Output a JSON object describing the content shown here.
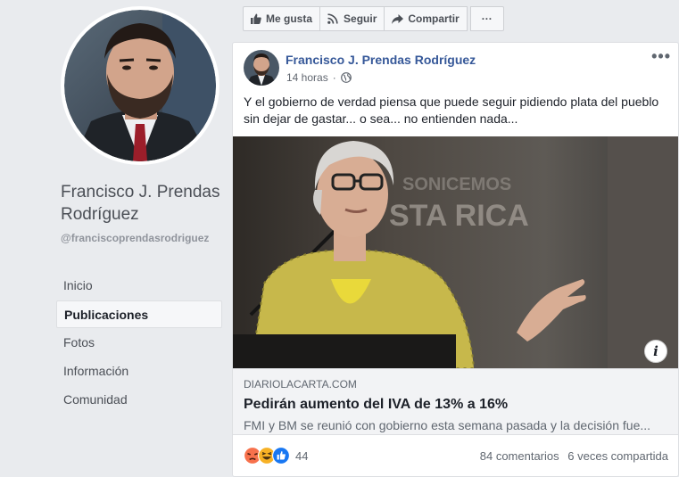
{
  "profile": {
    "name": "Francisco J. Prendas Rodríguez",
    "handle": "@franciscoprendasrodriguez"
  },
  "nav": {
    "items": [
      {
        "label": "Inicio",
        "active": false
      },
      {
        "label": "Publicaciones",
        "active": true
      },
      {
        "label": "Fotos",
        "active": false
      },
      {
        "label": "Información",
        "active": false
      },
      {
        "label": "Comunidad",
        "active": false
      }
    ]
  },
  "actions": {
    "like_label": "Me gusta",
    "follow_label": "Seguir",
    "share_label": "Compartir",
    "more_label": "···"
  },
  "post": {
    "author": "Francisco J. Prendas Rodríguez",
    "time": "14 horas",
    "menu": "•••",
    "text": "Y el gobierno de verdad piensa que puede seguir pidiendo plata del pueblo sin dejar de gastar... o sea... no entienden nada...",
    "link": {
      "domain": "DIARIOLACARTA.COM",
      "title": "Pedirán aumento del IVA de 13% a 16%",
      "description": "FMI y BM se reunió con gobierno esta semana pasada y la decisión fue..."
    },
    "image_bg_text_1": "SONICEMOS",
    "image_bg_text_2": "STA RICA",
    "reaction_count": "44",
    "comments": "84 comentarios",
    "shares": "6 veces compartida",
    "info_label": "i"
  },
  "colors": {
    "link_blue": "#365899",
    "page_bg": "#e9ebee",
    "like_blue": "#1877f2",
    "angry_orange": "#f7714c",
    "haha_yellow": "#f7b125"
  }
}
